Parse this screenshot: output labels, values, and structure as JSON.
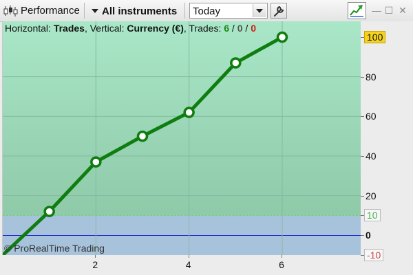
{
  "toolbar": {
    "perf_icon": "candlestick-icon",
    "performance_label": "Performance",
    "instruments_label": "All instruments",
    "period_value": "Today",
    "wrench_icon": "wrench-icon",
    "chart_icon": "chart-icon"
  },
  "window_controls": {
    "close": "✕",
    "minimize": "—",
    "maximize": "☐",
    "close2": "✕"
  },
  "info": {
    "horizontal_label": "Horizontal: ",
    "horizontal_value": "Trades",
    "vertical_label": ", Vertical: ",
    "vertical_value": "Currency (€)",
    "trades_label": ", Trades: ",
    "trades_won": "6",
    "sep1": " / ",
    "trades_even": "0",
    "sep2": " / ",
    "trades_lost": "0"
  },
  "copyright": "© ProRealTime Trading",
  "colors": {
    "line": "#0f7d0f",
    "positive_bg": "#a9e7c8",
    "negative_bg": "#a7c3dc",
    "zero_line": "#1e2ccf",
    "last_value_bg": "#f6d21f"
  },
  "chart_data": {
    "type": "line",
    "x": [
      0,
      1,
      2,
      3,
      4,
      5,
      6
    ],
    "series": [
      {
        "values": [
          -10,
          12,
          37,
          50,
          62,
          87,
          100
        ]
      }
    ],
    "xlim": [
      0,
      7.7
    ],
    "ylim": [
      -10,
      108
    ],
    "x_ticks": [
      "2",
      "4",
      "6"
    ],
    "x_tick_values": [
      2,
      4,
      6
    ],
    "y_ticks": [
      "20",
      "40",
      "60",
      "80"
    ],
    "y_tick_values": [
      20,
      40,
      60,
      80
    ],
    "zero_label": "0",
    "last_value_label": "100",
    "threshold_label": "10",
    "threshold_value": 10,
    "negative_label": "-10",
    "negative_value": -10,
    "grid": true
  }
}
